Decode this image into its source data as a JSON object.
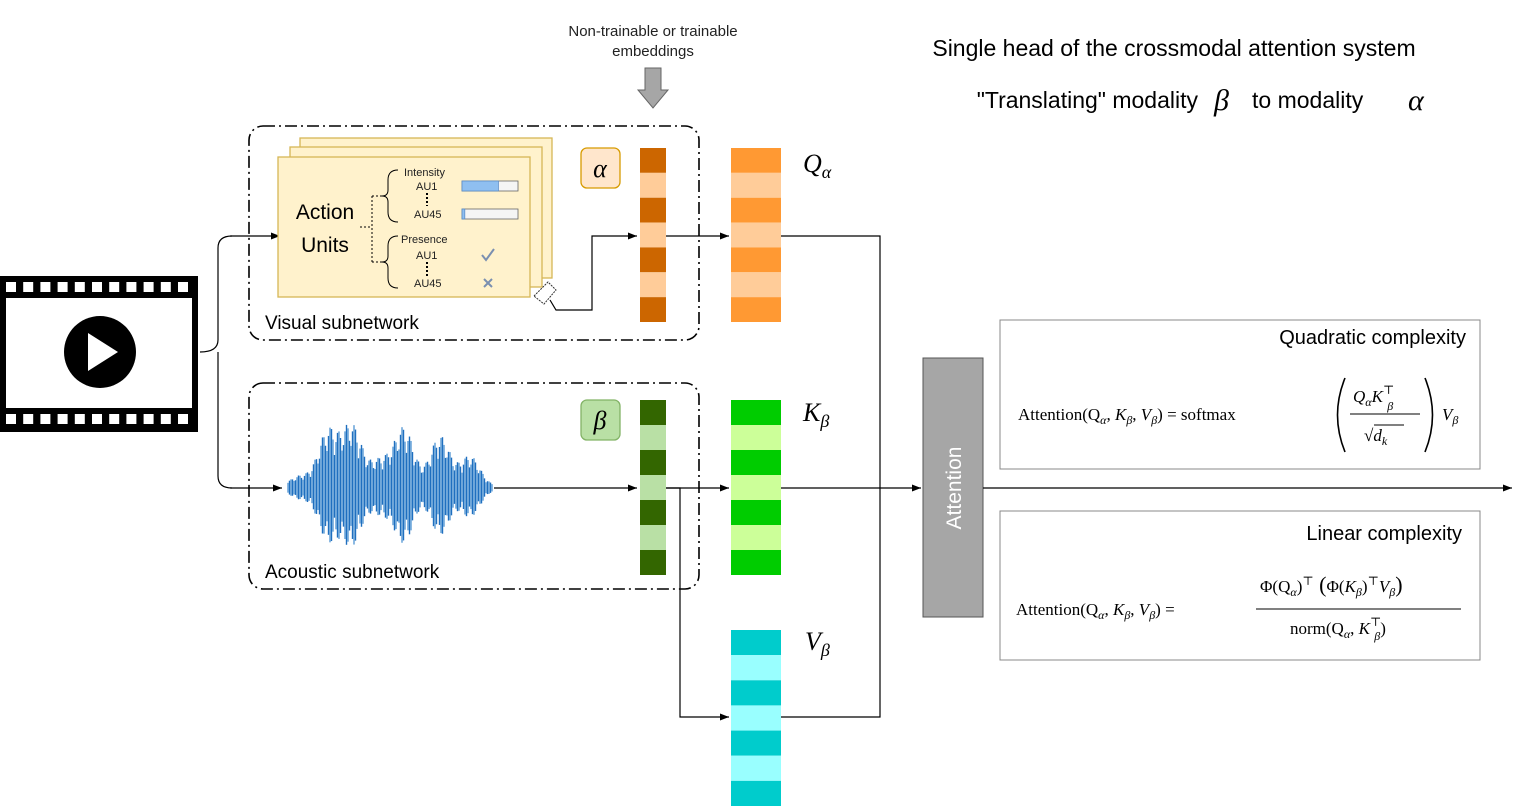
{
  "title": {
    "line1": "Single head of the crossmodal attention system",
    "line2_prefix": "\"Translating\" modality",
    "line2_beta": "β",
    "line2_mid": "to modality",
    "line2_alpha": "α"
  },
  "embeddings_label": {
    "line1": "Non-trainable or trainable",
    "line2": "embeddings"
  },
  "visual": {
    "subnetwork_label": "Visual subnetwork",
    "action_units_line1": "Action",
    "action_units_line2": "Units",
    "intensity_label": "Intensity",
    "presence_label": "Presence",
    "au_first": "AU1",
    "au_last": "AU45",
    "intensity_au1_fill": 0.65,
    "intensity_au45_fill": 0.05,
    "modality_symbol": "α",
    "colors": {
      "card_fill": "#fff2cc",
      "card_stroke": "#d6b656",
      "symbol_fill": "#ffe6cc",
      "symbol_stroke": "#d79b00"
    }
  },
  "acoustic": {
    "subnetwork_label": "Acoustic subnetwork",
    "modality_symbol": "β",
    "colors": {
      "symbol_fill": "#b9e0a5",
      "symbol_stroke": "#82b366",
      "wave": "#1f6fbf",
      "wave_light": "#5b9bd5"
    }
  },
  "matrices": {
    "q_label_main": "Q",
    "q_label_sub": "α",
    "k_label_main": "K",
    "k_label_sub": "β",
    "v_label_main": "V",
    "v_label_sub": "β",
    "colors": {
      "alpha_dark": "#cc6600",
      "alpha_light": "#ffcc99",
      "q_dark": "#ff9933",
      "q_light": "#ffcc99",
      "beta_dark": "#336600",
      "beta_light": "#b9e0a5",
      "k_dark": "#00cc00",
      "k_light": "#ccff99",
      "v_dark": "#00cccc",
      "v_light": "#99ffff"
    }
  },
  "attention_block": {
    "label": "Attention",
    "color": "#a6a6a6"
  },
  "quadratic": {
    "title": "Quadratic complexity",
    "formula_lhs": "Attention(Q",
    "formula_rhs": "softmax"
  },
  "linear": {
    "title": "Linear complexity",
    "formula_lhs": "Attention(Q",
    "numerator": "Φ(Q",
    "denominator": "norm(Q"
  }
}
